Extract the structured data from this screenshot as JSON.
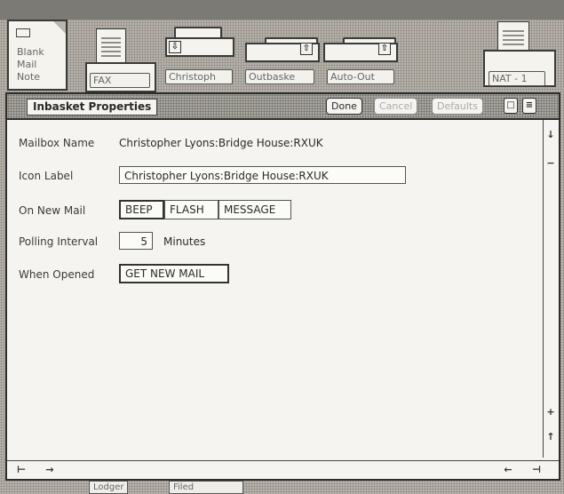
{
  "desktop": {
    "icons": {
      "blank_mail_note": [
        "Blank",
        "Mail",
        "Note"
      ],
      "fax": "FAX",
      "christoph": "Christoph",
      "outbasket": "Outbaske",
      "auto_out": "Auto-Out",
      "nat": "NAT - 1"
    },
    "peek_labels": [
      "Lodger",
      "Filed"
    ]
  },
  "window": {
    "title": "Inbasket Properties",
    "buttons": {
      "done": "Done",
      "cancel": "Cancel",
      "defaults": "Defaults"
    }
  },
  "properties": {
    "mailbox_name": {
      "label": "Mailbox Name",
      "value": "Christopher Lyons:Bridge House:RXUK"
    },
    "icon_label": {
      "label": "Icon Label",
      "value": "Christopher Lyons:Bridge House:RXUK"
    },
    "on_new_mail": {
      "label": "On New Mail",
      "options": [
        "BEEP",
        "FLASH",
        "MESSAGE"
      ]
    },
    "polling_interval": {
      "label": "Polling Interval",
      "value": "5",
      "unit": "Minutes"
    },
    "when_opened": {
      "label": "When Opened",
      "options": [
        "GET NEW MAIL"
      ]
    }
  },
  "colors": {
    "desktop": "#b9b6ae",
    "window_bg": "#f5f4f0",
    "border": "#2d2d2b"
  }
}
